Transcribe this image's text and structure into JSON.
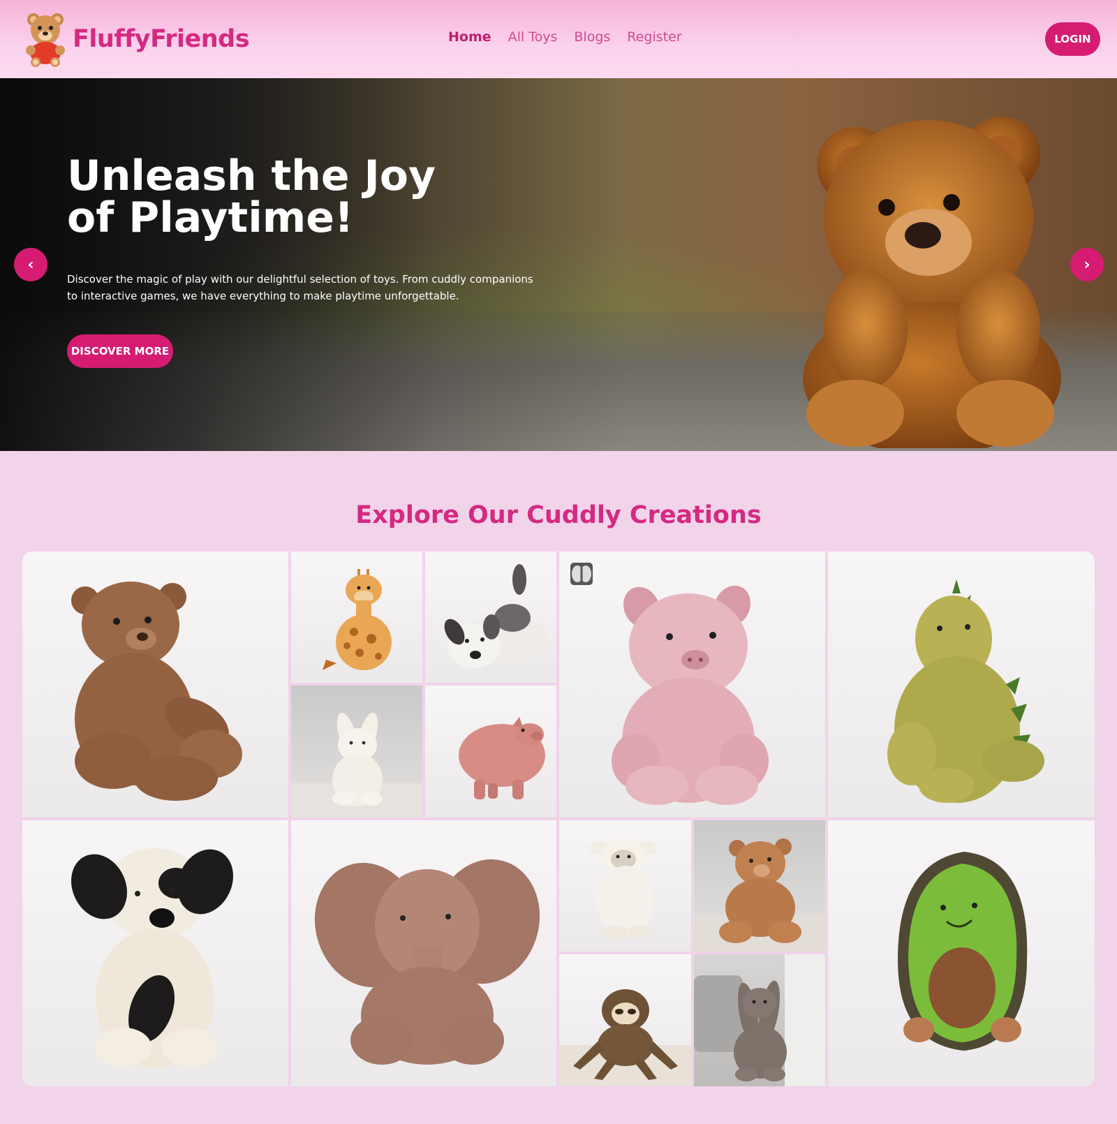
{
  "brand": {
    "name": "FluffyFriends",
    "logo_icon": "teddy-bear-logo-icon"
  },
  "nav": {
    "links": [
      {
        "label": "Home",
        "active": true
      },
      {
        "label": "All Toys",
        "active": false
      },
      {
        "label": "Blogs",
        "active": false
      },
      {
        "label": "Register",
        "active": false
      }
    ],
    "login_label": "LOGIN"
  },
  "hero": {
    "title": "Unleash the Joy of Playtime!",
    "description": "Discover the magic of play with our delightful selection of toys. From cuddly companions to interactive games, we have everything to make playtime unforgettable.",
    "cta_label": "DISCOVER MORE",
    "prev_icon": "chevron-left-icon",
    "next_icon": "chevron-right-icon"
  },
  "gallery": {
    "title": "Explore Our Cuddly Creations",
    "items": [
      "brown-teddy-bear",
      "giraffe-plush",
      "puppy-plush-lying",
      "bunny-plush",
      "pig-plush-standing",
      "pink-pig-plush",
      "green-dinosaur-plush",
      "black-white-puppy-plush",
      "elephant-plush",
      "lamb-plush",
      "small-teddy-bear",
      "sloth-plush",
      "grey-bunny-plush",
      "avocado-plush"
    ]
  },
  "colors": {
    "accent": "#d51c72",
    "brand": "#d42a82",
    "background": "#f1d3ea"
  }
}
